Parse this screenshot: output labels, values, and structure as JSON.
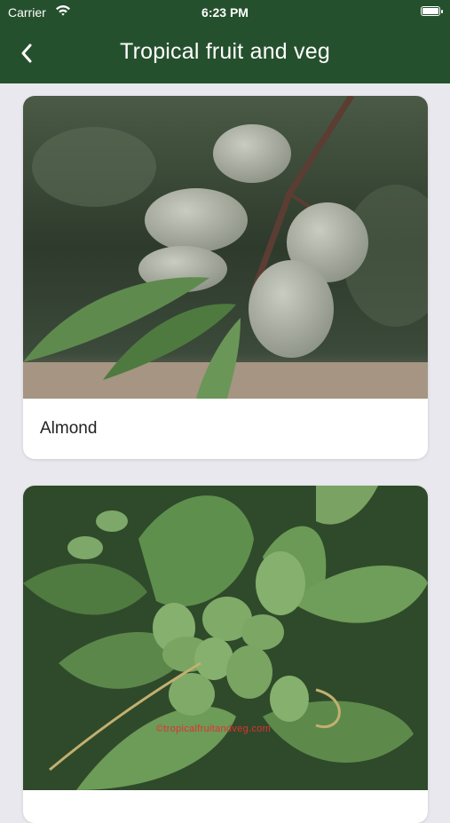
{
  "status_bar": {
    "carrier": "Carrier",
    "time": "6:23 PM"
  },
  "header": {
    "title": "Tropical fruit and veg",
    "back_icon": "chevron-left-icon"
  },
  "colors": {
    "header_bg": "#25502d",
    "page_bg": "#e8e8ee",
    "card_bg": "#ffffff"
  },
  "cards": [
    {
      "label": "Almond",
      "image": "almond-tree-branch-with-fuzzy-green-nuts"
    },
    {
      "label": "",
      "image": "tropical-almond-tree-cluster-of-green-fruits",
      "watermark": "©tropicalfruitandveg.com"
    }
  ]
}
